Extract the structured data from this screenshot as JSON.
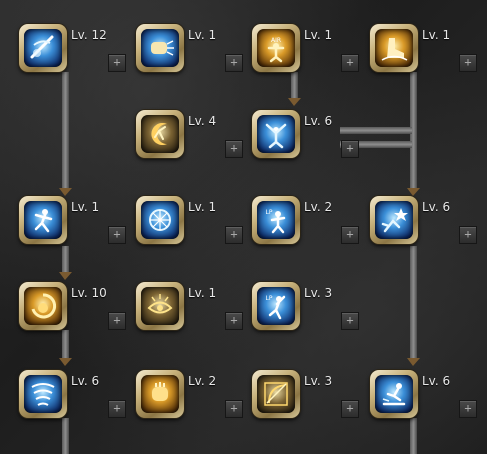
{
  "skill_tree": {
    "nodes": [
      {
        "id": "r1c1",
        "level": "Lv. 12",
        "icon": "blade-slash-icon",
        "tone": "blue",
        "plus": "+"
      },
      {
        "id": "r1c2",
        "level": "Lv. 1",
        "icon": "fist-strike-icon",
        "tone": "blue",
        "plus": "+"
      },
      {
        "id": "r1c3",
        "level": "Lv. 1",
        "icon": "air-stance-icon",
        "tone": "gold",
        "plus": "+",
        "icon_text": "AIR"
      },
      {
        "id": "r1c4",
        "level": "Lv. 1",
        "icon": "boot-kick-icon",
        "tone": "gold",
        "plus": "+"
      },
      {
        "id": "r2c2",
        "level": "Lv. 4",
        "icon": "crescent-kick-icon",
        "tone": "dark",
        "plus": "+"
      },
      {
        "id": "r2c3",
        "level": "Lv. 6",
        "icon": "overhead-smash-icon",
        "tone": "blue",
        "plus": "+"
      },
      {
        "id": "r3c1",
        "level": "Lv. 1",
        "icon": "dash-runner-icon",
        "tone": "blue",
        "plus": "+"
      },
      {
        "id": "r3c2",
        "level": "Lv. 1",
        "icon": "energy-burst-icon",
        "tone": "blue",
        "plus": "+"
      },
      {
        "id": "r3c3",
        "level": "Lv. 2",
        "icon": "lp-stance-icon",
        "tone": "blue",
        "plus": "+",
        "icon_text": "LP"
      },
      {
        "id": "r3c4",
        "level": "Lv. 6",
        "icon": "star-kick-icon",
        "tone": "blue",
        "plus": "+"
      },
      {
        "id": "r4c1",
        "level": "Lv. 10",
        "icon": "gold-whirl-icon",
        "tone": "gold",
        "plus": "+"
      },
      {
        "id": "r4c2",
        "level": "Lv. 1",
        "icon": "radiant-eye-icon",
        "tone": "dark",
        "plus": "+"
      },
      {
        "id": "r4c3",
        "level": "Lv. 3",
        "icon": "lp-uppercut-icon",
        "tone": "blue",
        "plus": "+",
        "icon_text": "LP"
      },
      {
        "id": "r5c1",
        "level": "Lv. 6",
        "icon": "tornado-spin-icon",
        "tone": "blue",
        "plus": "+"
      },
      {
        "id": "r5c2",
        "level": "Lv. 2",
        "icon": "golden-fist-icon",
        "tone": "gold",
        "plus": "+"
      },
      {
        "id": "r5c3",
        "level": "Lv. 3",
        "icon": "bow-shot-icon",
        "tone": "dark",
        "plus": "+"
      },
      {
        "id": "r5c4",
        "level": "Lv. 6",
        "icon": "air-combo-icon",
        "tone": "blue",
        "plus": "+"
      }
    ]
  }
}
